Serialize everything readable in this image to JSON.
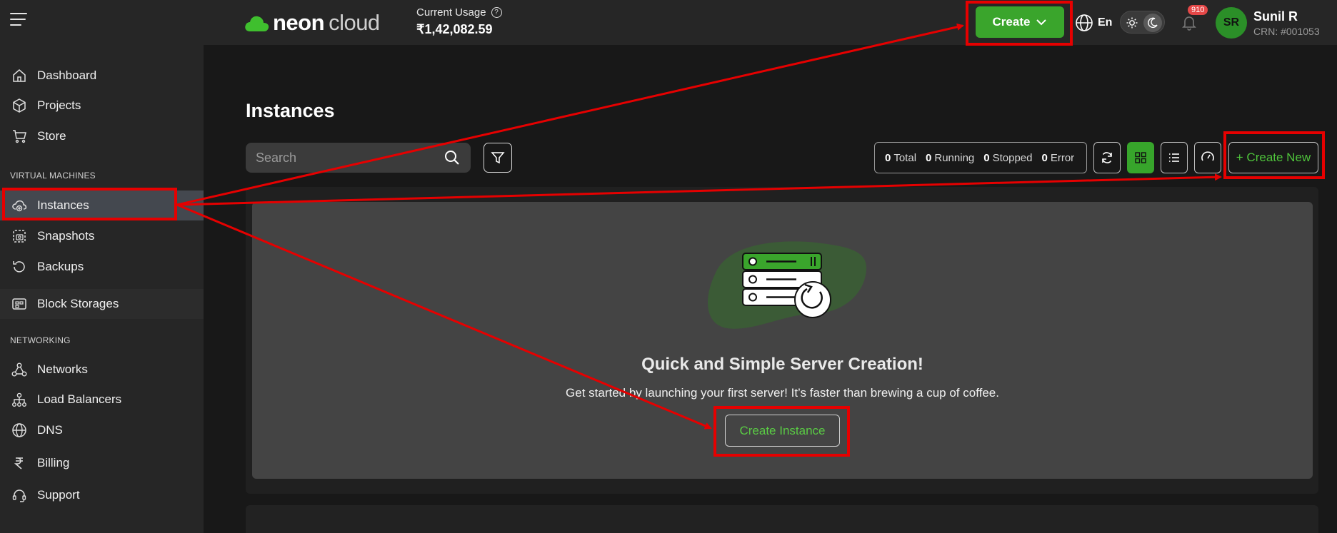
{
  "app": {
    "logo_primary": "neon",
    "logo_secondary": "cloud"
  },
  "topbar": {
    "usage_label": "Current Usage",
    "usage_help": "?",
    "usage_value": "₹1,42,082.59",
    "create_label": "Create",
    "language": "En",
    "notification_count": "910",
    "user_initials": "SR",
    "user_name": "Sunil R",
    "user_crn": "CRN: #001053"
  },
  "sidebar": {
    "items_top": [
      {
        "label": "Dashboard",
        "icon": "home-icon"
      },
      {
        "label": "Projects",
        "icon": "cube-icon"
      },
      {
        "label": "Store",
        "icon": "cart-icon"
      }
    ],
    "section_vm": "VIRTUAL MACHINES",
    "items_vm": [
      {
        "label": "Instances",
        "icon": "cloud-instance-icon",
        "active": true
      },
      {
        "label": "Snapshots",
        "icon": "snapshot-icon"
      },
      {
        "label": "Backups",
        "icon": "backup-icon"
      },
      {
        "label": "Block Storages",
        "icon": "storage-icon"
      }
    ],
    "section_net": "NETWORKING",
    "items_net": [
      {
        "label": "Networks",
        "icon": "network-icon"
      },
      {
        "label": "Load Balancers",
        "icon": "load-balancer-icon"
      },
      {
        "label": "DNS",
        "icon": "globe-icon"
      }
    ],
    "items_bottom": [
      {
        "label": "Billing",
        "icon": "rupee-icon"
      },
      {
        "label": "Support",
        "icon": "headset-icon"
      }
    ]
  },
  "main": {
    "title": "Instances",
    "search_placeholder": "Search",
    "stats": [
      {
        "value": "0",
        "label": "Total"
      },
      {
        "value": "0",
        "label": "Running"
      },
      {
        "value": "0",
        "label": "Stopped"
      },
      {
        "value": "0",
        "label": "Error"
      }
    ],
    "create_new_label": "+ Create New",
    "empty_title": "Quick and Simple Server Creation!",
    "empty_subtitle": "Get started by launching your first server! It’s faster than brewing a cup of coffee.",
    "create_instance_label": "Create Instance"
  },
  "colors": {
    "accent": "#3aa52c",
    "annotation": "#e60000",
    "sidebar_bg": "#262626",
    "content_bg": "#181818"
  }
}
